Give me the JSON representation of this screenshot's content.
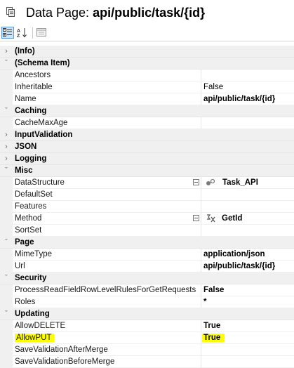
{
  "header": {
    "prefix": "Data Page:",
    "name": "api/public/task/{id}",
    "icon": "page-icon"
  },
  "toolbar": {
    "buttons": [
      "categorized-icon",
      "alphabetical-sort-icon",
      "property-pages-icon"
    ]
  },
  "grid": {
    "info": "(Info)",
    "schema": {
      "label": "(Schema Item)",
      "ancestors": "Ancestors",
      "inheritable": "Inheritable",
      "inheritable_value": "False",
      "name": "Name",
      "name_value": "api/public/task/{id}"
    },
    "caching": {
      "label": "Caching",
      "cachemaxage": "CacheMaxAge"
    },
    "inputvalidation": "InputValidation",
    "json": "JSON",
    "logging": "Logging",
    "misc": {
      "label": "Misc",
      "datastructure": "DataStructure",
      "datastructure_value": "Task_API",
      "defaultset": "DefaultSet",
      "features": "Features",
      "method": "Method",
      "method_value": "GetId",
      "sortset": "SortSet"
    },
    "page": {
      "label": "Page",
      "mimetype": "MimeType",
      "mimetype_value": "application/json",
      "url": "Url",
      "url_value": "api/public/task/{id}"
    },
    "security": {
      "label": "Security",
      "process": "ProcessReadFieldRowLevelRulesForGetRequests",
      "process_value": "False",
      "roles": "Roles",
      "roles_value": "*"
    },
    "updating": {
      "label": "Updating",
      "allowdelete": "AllowDELETE",
      "allowdelete_value": "True",
      "allowput": "AllowPUT",
      "allowput_value": "True",
      "savevalidationaftermerge": "SaveValidationAfterMerge",
      "savevalidationbeforemerge": "SaveValidationBeforeMerge"
    }
  },
  "colors": {
    "highlight": "#ffff00",
    "category_bg": "#f0f0f0",
    "active_button": "#cce4f7"
  }
}
